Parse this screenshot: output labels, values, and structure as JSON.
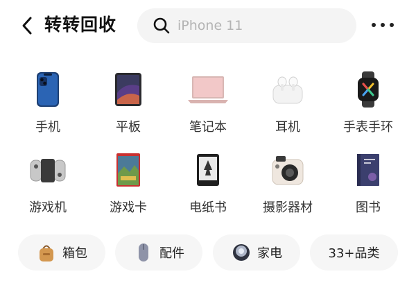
{
  "header": {
    "title": "转转回收",
    "search_placeholder": "iPhone 11",
    "back_icon": "chevron-left-icon",
    "search_icon": "search-icon",
    "more_icon": "more-horizontal-icon"
  },
  "categories": [
    {
      "label": "手机",
      "icon": "phone-icon"
    },
    {
      "label": "平板",
      "icon": "tablet-icon"
    },
    {
      "label": "笔记本",
      "icon": "laptop-icon"
    },
    {
      "label": "耳机",
      "icon": "earbuds-icon"
    },
    {
      "label": "手表手环",
      "icon": "watch-icon"
    },
    {
      "label": "游戏机",
      "icon": "game-console-icon"
    },
    {
      "label": "游戏卡",
      "icon": "game-card-icon"
    },
    {
      "label": "电纸书",
      "icon": "ereader-icon"
    },
    {
      "label": "摄影器材",
      "icon": "camera-icon"
    },
    {
      "label": "图书",
      "icon": "book-icon"
    }
  ],
  "pills": [
    {
      "label": "箱包",
      "icon": "bag-icon"
    },
    {
      "label": "配件",
      "icon": "mouse-icon"
    },
    {
      "label": "家电",
      "icon": "appliance-icon"
    },
    {
      "label": "33+品类",
      "icon": ""
    }
  ],
  "colors": {
    "search_bg": "#f4f4f4",
    "pill_bg": "#f6f6f6",
    "text": "#222222",
    "placeholder": "#b3b3b3"
  }
}
